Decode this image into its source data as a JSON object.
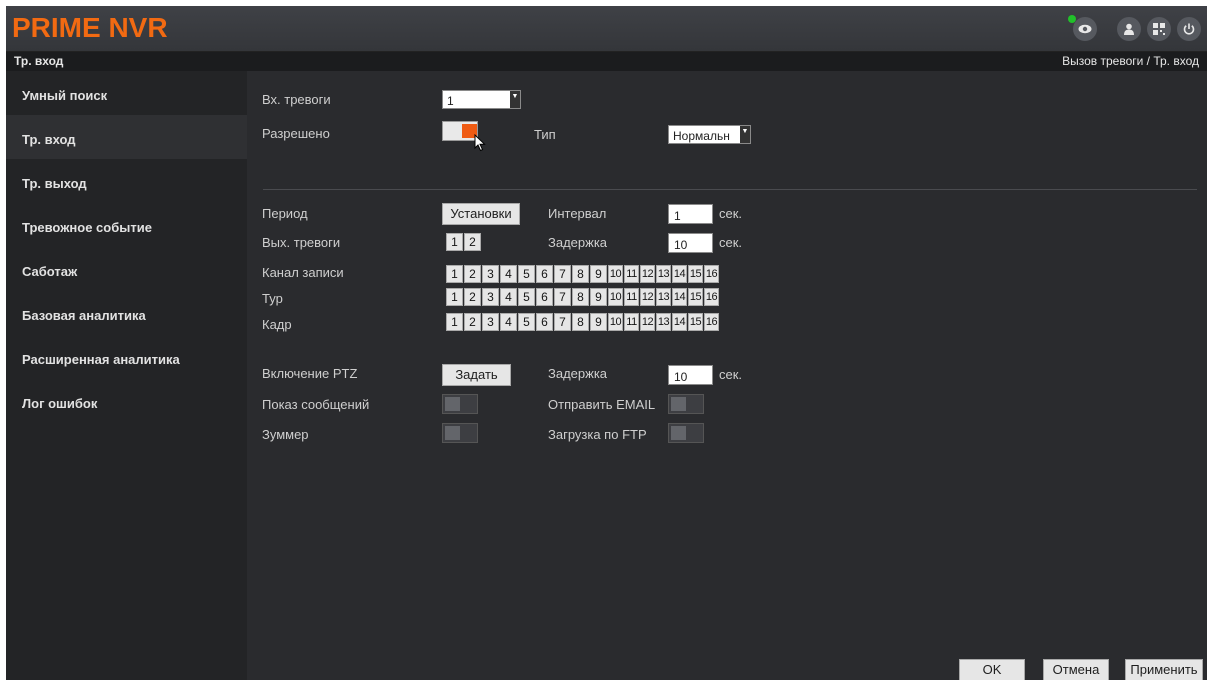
{
  "header": {
    "logo": "PRIME NVR",
    "icons": [
      "eye-icon",
      "user-icon",
      "qr-icon",
      "power-icon"
    ],
    "accent_color": "#f26a12",
    "live_status_color": "#21c02a"
  },
  "titlebar": {
    "title": "Тр. вход",
    "breadcrumb": "Вызов тревоги / Тр. вход"
  },
  "sidebar": {
    "items": [
      {
        "label": "Умный поиск"
      },
      {
        "label": "Тр. вход"
      },
      {
        "label": "Тр. выход"
      },
      {
        "label": "Тревожное событие"
      },
      {
        "label": "Саботаж"
      },
      {
        "label": "Базовая аналитика"
      },
      {
        "label": "Расширенная аналитика"
      },
      {
        "label": "Лог ошибок"
      }
    ],
    "active_index": 1
  },
  "form": {
    "alarm_input_label": "Вх. тревоги",
    "alarm_input_value": "1",
    "enabled_label": "Разрешено",
    "enabled": true,
    "type_label": "Тип",
    "type_value": "Нормальн",
    "period_label": "Период",
    "period_button": "Установки",
    "interval_label": "Интервал",
    "interval_value": "1",
    "interval_unit": "сек.",
    "alarm_out_label": "Вых. тревоги",
    "alarm_outputs": [
      "1",
      "2"
    ],
    "delay_label": "Задержка",
    "delay_value": "10",
    "delay_unit": "сек.",
    "record_channel_label": "Канал записи",
    "tour_label": "Тур",
    "frame_label": "Кадр",
    "channels": [
      "1",
      "2",
      "3",
      "4",
      "5",
      "6",
      "7",
      "8",
      "9",
      "10",
      "11",
      "12",
      "13",
      "14",
      "15",
      "16"
    ],
    "ptz_label": "Включение PTZ",
    "ptz_button": "Задать",
    "ptz_delay_label": "Задержка",
    "ptz_delay_value": "10",
    "ptz_delay_unit": "сек.",
    "show_message_label": "Показ сообщений",
    "show_message": false,
    "send_email_label": "Отправить EMAIL",
    "send_email": false,
    "buzzer_label": "Зуммер",
    "buzzer": false,
    "ftp_label": "Загрузка по FTP",
    "ftp": false
  },
  "footer": {
    "ok": "OK",
    "cancel": "Отмена",
    "apply": "Применить"
  }
}
